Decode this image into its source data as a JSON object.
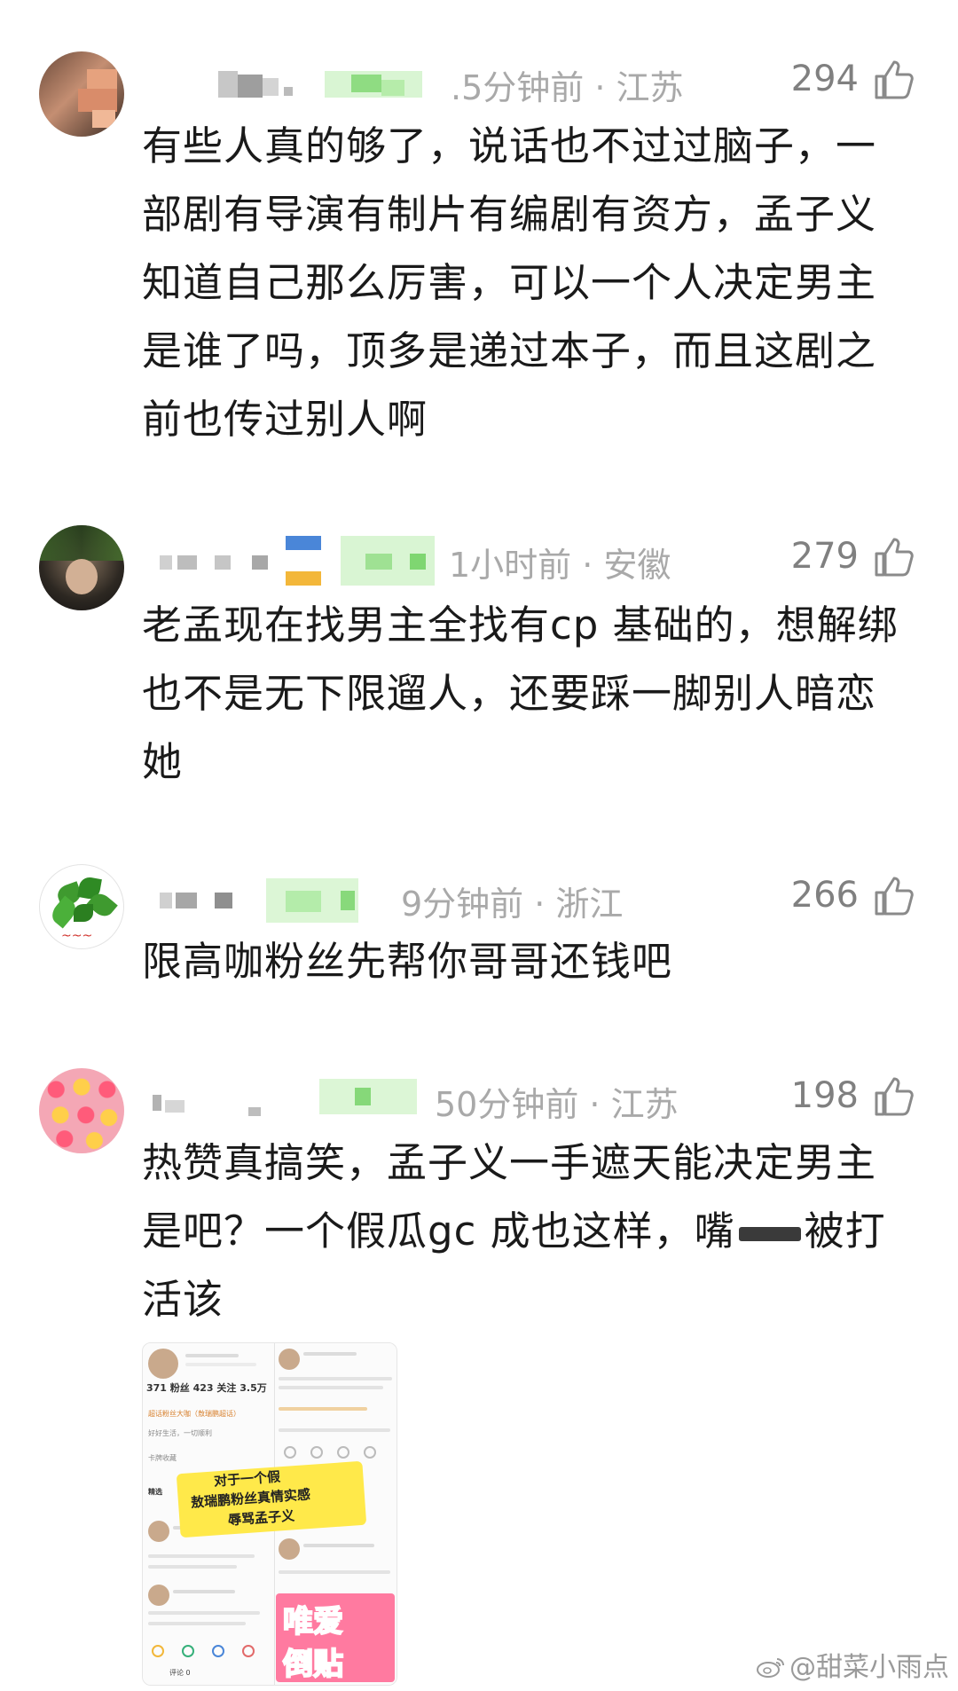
{
  "comments": [
    {
      "meta": ".5分钟前 · 江苏",
      "likes": "294",
      "text": "有些人真的够了，说话也不过过脑子，一部剧有导演有制片有编剧有资方，孟子义知道自己那么厉害，可以一个人决定男主是谁了吗，顶多是递过本子，而且这剧之前也传过别人啊"
    },
    {
      "meta": "1小时前 · 安徽",
      "likes": "279",
      "text": "老孟现在找男主全找有cp 基础的，想解绑也不是无下限遛人，还要踩一脚别人暗恋她"
    },
    {
      "meta": "9分钟前 · 浙江",
      "likes": "266",
      "text": "限高咖粉丝先帮你哥哥还钱吧"
    },
    {
      "meta": "50分钟前 · 江苏",
      "likes": "198",
      "text_a": "热赞真搞笑，孟子义一手遮天能决定男主是吧？一个假瓜gc 成也这样，嘴",
      "text_b": "被打活该",
      "image": {
        "stats": "371 粉丝   423 关注   3.5万",
        "caption_lines": [
          "对于一个假",
          "敖瑞鹏粉丝真情实感",
          "辱骂孟子义"
        ],
        "sticker_lines": [
          "唯爱",
          "倒贴"
        ],
        "mini_texts": [
          "超话粉丝大咖（敖瑞鹏超话）",
          "好好生活，一切顺利",
          "卡牌收藏",
          "精选",
          "评论 0"
        ]
      }
    }
  ],
  "watermark": "@甜菜小雨点",
  "colors": {
    "meta_gray": "#a9a9a9",
    "text": "#1a1a1a",
    "blur_green": "#b9f0b0",
    "blur_gray": "#bdbdbd"
  },
  "icons": [
    "thumbs-up-icon",
    "weibo-icon"
  ]
}
